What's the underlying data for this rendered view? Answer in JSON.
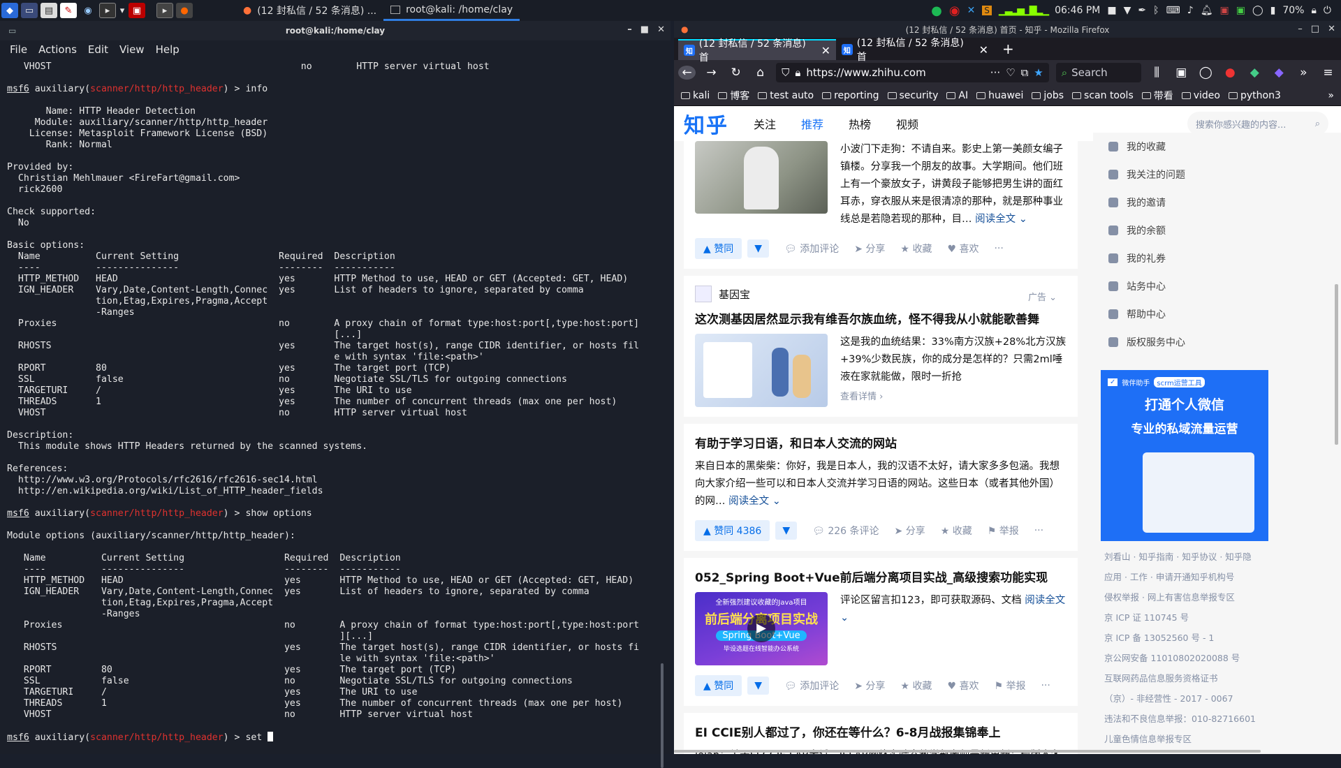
{
  "panel": {
    "task1": "(12 封私信 / 52 条消息) ...",
    "task2": "root@kali: /home/clay",
    "time": "06:46 PM",
    "battery": "70%"
  },
  "terminal": {
    "title": "root@kali:/home/clay",
    "menu": [
      "File",
      "Actions",
      "Edit",
      "View",
      "Help"
    ],
    "module_path": "scanner/http/http_header",
    "prompt_prefix": "msf6",
    "prompt_auxiliary": " auxiliary(",
    "prompt_suffix": ") > ",
    "cmd_info": "info",
    "cmd_show": "show options",
    "cmd_set": "set ",
    "lines_top": [
      "   VHOST                                             no        HTTP server virtual host",
      ""
    ],
    "lines_info": [
      "",
      "       Name: HTTP Header Detection",
      "     Module: auxiliary/scanner/http/http_header",
      "    License: Metasploit Framework License (BSD)",
      "       Rank: Normal",
      "",
      "Provided by:",
      "  Christian Mehlmauer <FireFart@gmail.com>",
      "  rick2600",
      "",
      "Check supported:",
      "  No",
      "",
      "Basic options:",
      "  Name          Current Setting                  Required  Description",
      "  ----          ---------------                  --------  -----------",
      "  HTTP_METHOD   HEAD                             yes       HTTP Method to use, HEAD or GET (Accepted: GET, HEAD)",
      "  IGN_HEADER    Vary,Date,Content-Length,Connec  yes       List of headers to ignore, separated by comma",
      "                tion,Etag,Expires,Pragma,Accept",
      "                -Ranges",
      "  Proxies                                        no        A proxy chain of format type:host:port[,type:host:port]",
      "                                                           [...]",
      "  RHOSTS                                         yes       The target host(s), range CIDR identifier, or hosts fil",
      "                                                           e with syntax 'file:<path>'",
      "  RPORT         80                               yes       The target port (TCP)",
      "  SSL           false                            no        Negotiate SSL/TLS for outgoing connections",
      "  TARGETURI     /                                yes       The URI to use",
      "  THREADS       1                                yes       The number of concurrent threads (max one per host)",
      "  VHOST                                          no        HTTP server virtual host",
      "",
      "Description:",
      "  This module shows HTTP Headers returned by the scanned systems.",
      "",
      "References:",
      "  http://www.w3.org/Protocols/rfc2616/rfc2616-sec14.html",
      "  http://en.wikipedia.org/wiki/List_of_HTTP_header_fields",
      ""
    ],
    "lines_show": [
      "",
      "Module options (auxiliary/scanner/http/http_header):",
      "",
      "   Name          Current Setting                  Required  Description",
      "   ----          ---------------                  --------  -----------",
      "   HTTP_METHOD   HEAD                             yes       HTTP Method to use, HEAD or GET (Accepted: GET, HEAD)",
      "   IGN_HEADER    Vary,Date,Content-Length,Connec  yes       List of headers to ignore, separated by comma",
      "                 tion,Etag,Expires,Pragma,Accept",
      "                 -Ranges",
      "   Proxies                                        no        A proxy chain of format type:host:port[,type:host:port",
      "                                                            ][...]",
      "   RHOSTS                                         yes       The target host(s), range CIDR identifier, or hosts fi",
      "                                                            le with syntax 'file:<path>'",
      "   RPORT         80                               yes       The target port (TCP)",
      "   SSL           false                            no        Negotiate SSL/TLS for outgoing connections",
      "   TARGETURI     /                                yes       The URI to use",
      "   THREADS       1                                yes       The number of concurrent threads (max one per host)",
      "   VHOST                                          no        HTTP server virtual host",
      ""
    ]
  },
  "firefox": {
    "title": "(12 封私信 / 52 条消息) 首页 - 知乎 - Mozilla Firefox",
    "tabs": [
      {
        "label": "(12 封私信 / 52 条消息) 首"
      },
      {
        "label": "(12 封私信 / 52 条消息) 首"
      }
    ],
    "url": "https://www.zhihu.com",
    "search_placeholder": "Search",
    "bookmarks": [
      "kali",
      "博客",
      "test auto",
      "reporting",
      "security",
      "AI",
      "huawei",
      "jobs",
      "scan tools",
      "带看",
      "video",
      "python3"
    ]
  },
  "zhihu": {
    "logo": "知乎",
    "nav": [
      "关注",
      "推荐",
      "热榜",
      "视频"
    ],
    "search_placeholder": "搜索你感兴趣的内容...",
    "card1": {
      "text": "小波门下走狗：不请自来。影史上第一美颜女编子镇楼。分享我一个朋友的故事。大学期间。他们班上有一个豪放女子，讲黄段子能够把男生讲的面红耳赤，穿衣服从来是很清凉的那种，就是那种事业线总是若隐若现的那种，目…",
      "read_more": "阅读全文",
      "actions": [
        "赞同",
        "添加评论",
        "分享",
        "收藏",
        "喜欢",
        "···"
      ]
    },
    "card2": {
      "author": "基因宝",
      "ad_label": "广告",
      "title": "这次测基因居然显示我有维吾尔族血统，怪不得我从小就能歌善舞",
      "text": "这是我的血统结果：33%南方汉族+28%北方汉族+39%少数民族，你的成分是怎样的？只需2ml唾液在家就能做，限时一折抢",
      "more": "查看详情"
    },
    "card3": {
      "title": "有助于学习日语，和日本人交流的网站",
      "text": "来自日本的黑柴柴：你好，我是日本人，我的汉语不太好，请大家多多包涵。我想向大家介绍一些可以和日本人交流并学习日语的网站。这些日本（或者其他外国）的网…",
      "read_more": "阅读全文",
      "vote": "赞同 4386",
      "comments": "226 条评论",
      "actions": [
        "分享",
        "收藏",
        "举报",
        "···"
      ]
    },
    "card4": {
      "title": "052_Spring Boot+Vue前后端分离项目实战_高级搜索功能实现",
      "text": "评论区留言扣123，即可获取源码、文档",
      "read_more": "阅读全文",
      "thumb_top": "全新强烈建议收藏的Java项目",
      "thumb_mid": "前后端分离项目实战",
      "thumb_spring": "Spring Boot+Vue",
      "thumb_bottom": "毕设选题在线智能办公系统",
      "actions": [
        "赞同",
        "添加评论",
        "分享",
        "收藏",
        "喜欢",
        "举报",
        "···"
      ]
    },
    "card5": {
      "title": "EI CCIE别人都过了，你还在等什么？6-8月战报集锦奉上",
      "text": "ielab：关于EI CCIE LAB考试，IELAB网络实验室教学部老师最新更新：现版本各考场稳过PASS…"
    },
    "sidebar": [
      "我的收藏",
      "我关注的问题",
      "我的邀请",
      "我的余额",
      "我的礼券",
      "站务中心",
      "帮助中心",
      "版权服务中心"
    ],
    "ad": {
      "badge": "微伴助手",
      "tag": "scrm运营工具",
      "line1": "打通个人微信",
      "line2": "专业的私域流量运营"
    },
    "footer": [
      "刘看山 · 知乎指南 · 知乎协议 · 知乎隐",
      "应用 · 工作 · 申请开通知乎机构号",
      "侵权举报 · 网上有害信息举报专区",
      "京 ICP 证 110745 号",
      "京 ICP 备 13052560 号 - 1",
      "京公网安备 11010802020088 号",
      "互联网药品信息服务资格证书",
      "（京）- 非经营性 - 2017 - 0067",
      "违法和不良信息举报：010-82716601",
      "儿童色情信息举报专区"
    ]
  }
}
